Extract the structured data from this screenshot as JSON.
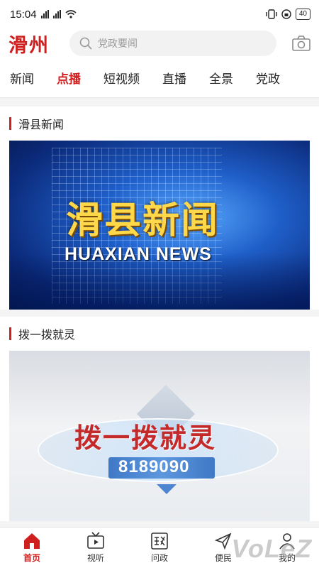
{
  "status": {
    "time": "15:04",
    "net": "3G",
    "battery": "40"
  },
  "app": {
    "logo_text": "滑州"
  },
  "search": {
    "placeholder": "党政要闻"
  },
  "tabs": [
    {
      "label": "新闻"
    },
    {
      "label": "点播"
    },
    {
      "label": "短视频"
    },
    {
      "label": "直播"
    },
    {
      "label": "全景"
    },
    {
      "label": "党政"
    }
  ],
  "sections": [
    {
      "title": "滑县新闻",
      "thumb_cn": "滑县新闻",
      "thumb_en": "HUAXIAN NEWS"
    },
    {
      "title": "拨一拨就灵",
      "thumb_cn": "拨一拨就灵",
      "thumb_num": "8189090"
    }
  ],
  "bottom_nav": [
    {
      "label": "首页",
      "icon": "home-icon"
    },
    {
      "label": "视听",
      "icon": "tv-icon"
    },
    {
      "label": "问政",
      "icon": "zheng-icon"
    },
    {
      "label": "便民",
      "icon": "send-icon"
    },
    {
      "label": "我的",
      "icon": "user-icon"
    }
  ],
  "watermark": "VoLeZ",
  "colors": {
    "accent": "#d01f1f"
  }
}
